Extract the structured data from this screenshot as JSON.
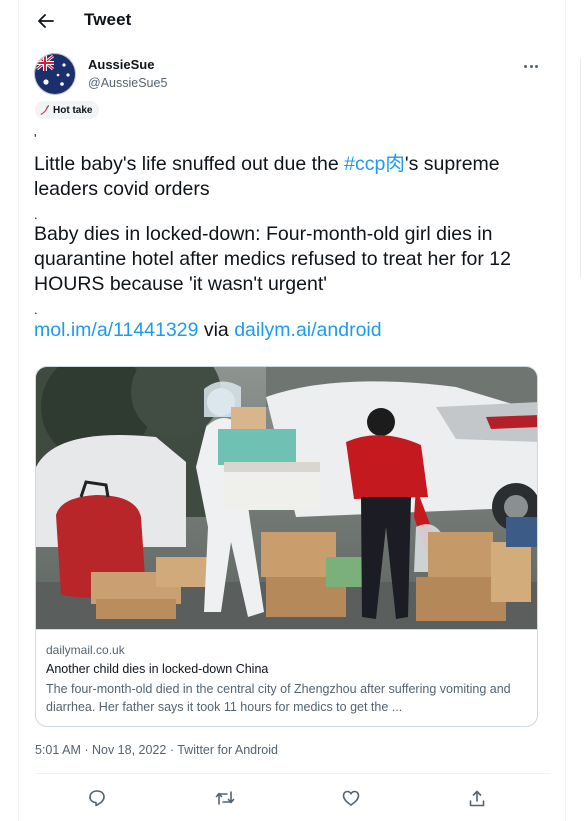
{
  "header": {
    "title": "Tweet",
    "back_icon": "arrow-left-icon"
  },
  "author": {
    "display_name": "AussieSue",
    "handle": "@AussieSue5",
    "avatar_icon": "australian-flag-avatar"
  },
  "badge": {
    "label": "Hot take",
    "icon": "chili-pepper-icon"
  },
  "tweet": {
    "mark_top": "'",
    "line1_pre": "Little baby's life snuffed out due the ",
    "hashtag": "#ccp肉",
    "line1_post": "'s supreme leaders covid orders",
    "dot1": ".",
    "paragraph2": "Baby dies in locked-down: Four-month-old girl dies in quarantine hotel after medics refused to treat her for 12 HOURS because 'it wasn't urgent'",
    "dot2": ".",
    "link1": "mol.im/a/11441329",
    "via": " via ",
    "link2": "dailym.ai/android"
  },
  "card": {
    "domain": "dailymail.co.uk",
    "title": "Another child dies in locked-down China",
    "description": "The four-month-old died in the central city of Zhengzhou after suffering vomiting and diarrhea. Her father says it took 11 hours for medics to get the ..."
  },
  "meta": {
    "time": "5:01 AM",
    "separator": " · ",
    "date": "Nov 18, 2022",
    "source": "Twitter for Android"
  },
  "actions": [
    "reply-icon",
    "retweet-icon",
    "like-icon",
    "share-icon"
  ],
  "colors": {
    "accent": "#1d9bf0",
    "text": "#0f1419",
    "muted": "#536471",
    "border": "#cfd9de"
  }
}
